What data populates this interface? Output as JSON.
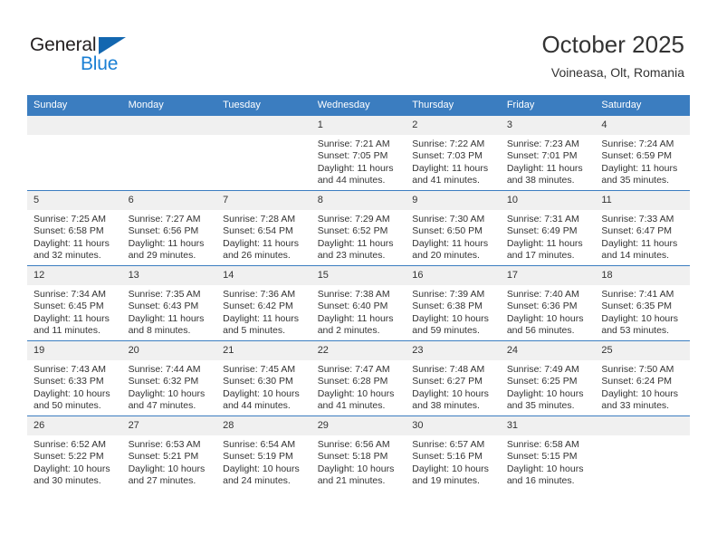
{
  "brand": {
    "name_part1": "General",
    "name_part2": "Blue",
    "triangle_color": "#1367b0",
    "blue_color": "#1a7fd4"
  },
  "header": {
    "title": "October 2025",
    "subtitle": "Voineasa, Olt, Romania"
  },
  "theme": {
    "header_bg": "#3b7dc0",
    "daynum_bg": "#f0f0f0",
    "text": "#333333"
  },
  "weekdays": [
    "Sunday",
    "Monday",
    "Tuesday",
    "Wednesday",
    "Thursday",
    "Friday",
    "Saturday"
  ],
  "weeks": [
    [
      {
        "day": "",
        "sunrise": "",
        "sunset": "",
        "daylight_line1": "",
        "daylight_line2": ""
      },
      {
        "day": "",
        "sunrise": "",
        "sunset": "",
        "daylight_line1": "",
        "daylight_line2": ""
      },
      {
        "day": "",
        "sunrise": "",
        "sunset": "",
        "daylight_line1": "",
        "daylight_line2": ""
      },
      {
        "day": "1",
        "sunrise": "Sunrise: 7:21 AM",
        "sunset": "Sunset: 7:05 PM",
        "daylight_line1": "Daylight: 11 hours",
        "daylight_line2": "and 44 minutes."
      },
      {
        "day": "2",
        "sunrise": "Sunrise: 7:22 AM",
        "sunset": "Sunset: 7:03 PM",
        "daylight_line1": "Daylight: 11 hours",
        "daylight_line2": "and 41 minutes."
      },
      {
        "day": "3",
        "sunrise": "Sunrise: 7:23 AM",
        "sunset": "Sunset: 7:01 PM",
        "daylight_line1": "Daylight: 11 hours",
        "daylight_line2": "and 38 minutes."
      },
      {
        "day": "4",
        "sunrise": "Sunrise: 7:24 AM",
        "sunset": "Sunset: 6:59 PM",
        "daylight_line1": "Daylight: 11 hours",
        "daylight_line2": "and 35 minutes."
      }
    ],
    [
      {
        "day": "5",
        "sunrise": "Sunrise: 7:25 AM",
        "sunset": "Sunset: 6:58 PM",
        "daylight_line1": "Daylight: 11 hours",
        "daylight_line2": "and 32 minutes."
      },
      {
        "day": "6",
        "sunrise": "Sunrise: 7:27 AM",
        "sunset": "Sunset: 6:56 PM",
        "daylight_line1": "Daylight: 11 hours",
        "daylight_line2": "and 29 minutes."
      },
      {
        "day": "7",
        "sunrise": "Sunrise: 7:28 AM",
        "sunset": "Sunset: 6:54 PM",
        "daylight_line1": "Daylight: 11 hours",
        "daylight_line2": "and 26 minutes."
      },
      {
        "day": "8",
        "sunrise": "Sunrise: 7:29 AM",
        "sunset": "Sunset: 6:52 PM",
        "daylight_line1": "Daylight: 11 hours",
        "daylight_line2": "and 23 minutes."
      },
      {
        "day": "9",
        "sunrise": "Sunrise: 7:30 AM",
        "sunset": "Sunset: 6:50 PM",
        "daylight_line1": "Daylight: 11 hours",
        "daylight_line2": "and 20 minutes."
      },
      {
        "day": "10",
        "sunrise": "Sunrise: 7:31 AM",
        "sunset": "Sunset: 6:49 PM",
        "daylight_line1": "Daylight: 11 hours",
        "daylight_line2": "and 17 minutes."
      },
      {
        "day": "11",
        "sunrise": "Sunrise: 7:33 AM",
        "sunset": "Sunset: 6:47 PM",
        "daylight_line1": "Daylight: 11 hours",
        "daylight_line2": "and 14 minutes."
      }
    ],
    [
      {
        "day": "12",
        "sunrise": "Sunrise: 7:34 AM",
        "sunset": "Sunset: 6:45 PM",
        "daylight_line1": "Daylight: 11 hours",
        "daylight_line2": "and 11 minutes."
      },
      {
        "day": "13",
        "sunrise": "Sunrise: 7:35 AM",
        "sunset": "Sunset: 6:43 PM",
        "daylight_line1": "Daylight: 11 hours",
        "daylight_line2": "and 8 minutes."
      },
      {
        "day": "14",
        "sunrise": "Sunrise: 7:36 AM",
        "sunset": "Sunset: 6:42 PM",
        "daylight_line1": "Daylight: 11 hours",
        "daylight_line2": "and 5 minutes."
      },
      {
        "day": "15",
        "sunrise": "Sunrise: 7:38 AM",
        "sunset": "Sunset: 6:40 PM",
        "daylight_line1": "Daylight: 11 hours",
        "daylight_line2": "and 2 minutes."
      },
      {
        "day": "16",
        "sunrise": "Sunrise: 7:39 AM",
        "sunset": "Sunset: 6:38 PM",
        "daylight_line1": "Daylight: 10 hours",
        "daylight_line2": "and 59 minutes."
      },
      {
        "day": "17",
        "sunrise": "Sunrise: 7:40 AM",
        "sunset": "Sunset: 6:36 PM",
        "daylight_line1": "Daylight: 10 hours",
        "daylight_line2": "and 56 minutes."
      },
      {
        "day": "18",
        "sunrise": "Sunrise: 7:41 AM",
        "sunset": "Sunset: 6:35 PM",
        "daylight_line1": "Daylight: 10 hours",
        "daylight_line2": "and 53 minutes."
      }
    ],
    [
      {
        "day": "19",
        "sunrise": "Sunrise: 7:43 AM",
        "sunset": "Sunset: 6:33 PM",
        "daylight_line1": "Daylight: 10 hours",
        "daylight_line2": "and 50 minutes."
      },
      {
        "day": "20",
        "sunrise": "Sunrise: 7:44 AM",
        "sunset": "Sunset: 6:32 PM",
        "daylight_line1": "Daylight: 10 hours",
        "daylight_line2": "and 47 minutes."
      },
      {
        "day": "21",
        "sunrise": "Sunrise: 7:45 AM",
        "sunset": "Sunset: 6:30 PM",
        "daylight_line1": "Daylight: 10 hours",
        "daylight_line2": "and 44 minutes."
      },
      {
        "day": "22",
        "sunrise": "Sunrise: 7:47 AM",
        "sunset": "Sunset: 6:28 PM",
        "daylight_line1": "Daylight: 10 hours",
        "daylight_line2": "and 41 minutes."
      },
      {
        "day": "23",
        "sunrise": "Sunrise: 7:48 AM",
        "sunset": "Sunset: 6:27 PM",
        "daylight_line1": "Daylight: 10 hours",
        "daylight_line2": "and 38 minutes."
      },
      {
        "day": "24",
        "sunrise": "Sunrise: 7:49 AM",
        "sunset": "Sunset: 6:25 PM",
        "daylight_line1": "Daylight: 10 hours",
        "daylight_line2": "and 35 minutes."
      },
      {
        "day": "25",
        "sunrise": "Sunrise: 7:50 AM",
        "sunset": "Sunset: 6:24 PM",
        "daylight_line1": "Daylight: 10 hours",
        "daylight_line2": "and 33 minutes."
      }
    ],
    [
      {
        "day": "26",
        "sunrise": "Sunrise: 6:52 AM",
        "sunset": "Sunset: 5:22 PM",
        "daylight_line1": "Daylight: 10 hours",
        "daylight_line2": "and 30 minutes."
      },
      {
        "day": "27",
        "sunrise": "Sunrise: 6:53 AM",
        "sunset": "Sunset: 5:21 PM",
        "daylight_line1": "Daylight: 10 hours",
        "daylight_line2": "and 27 minutes."
      },
      {
        "day": "28",
        "sunrise": "Sunrise: 6:54 AM",
        "sunset": "Sunset: 5:19 PM",
        "daylight_line1": "Daylight: 10 hours",
        "daylight_line2": "and 24 minutes."
      },
      {
        "day": "29",
        "sunrise": "Sunrise: 6:56 AM",
        "sunset": "Sunset: 5:18 PM",
        "daylight_line1": "Daylight: 10 hours",
        "daylight_line2": "and 21 minutes."
      },
      {
        "day": "30",
        "sunrise": "Sunrise: 6:57 AM",
        "sunset": "Sunset: 5:16 PM",
        "daylight_line1": "Daylight: 10 hours",
        "daylight_line2": "and 19 minutes."
      },
      {
        "day": "31",
        "sunrise": "Sunrise: 6:58 AM",
        "sunset": "Sunset: 5:15 PM",
        "daylight_line1": "Daylight: 10 hours",
        "daylight_line2": "and 16 minutes."
      },
      {
        "day": "",
        "sunrise": "",
        "sunset": "",
        "daylight_line1": "",
        "daylight_line2": ""
      }
    ]
  ]
}
